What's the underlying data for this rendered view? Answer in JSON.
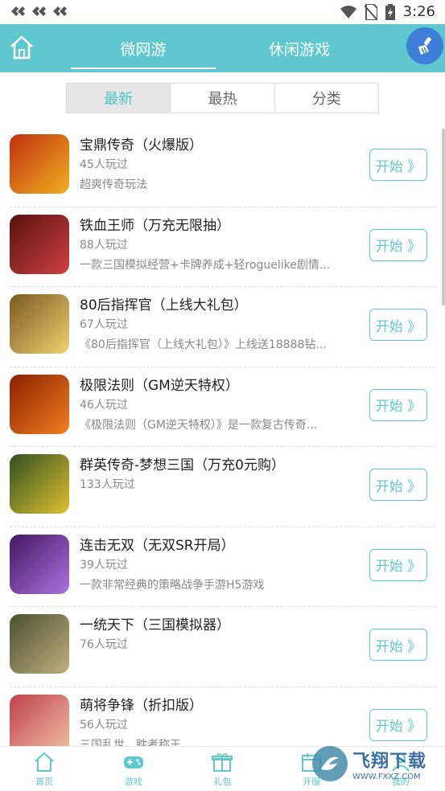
{
  "status": {
    "time": "3:26"
  },
  "header": {
    "tabs": [
      {
        "label": "微网游",
        "active": true
      },
      {
        "label": "休闲游戏",
        "active": false
      }
    ]
  },
  "segments": [
    {
      "label": "最新",
      "active": true
    },
    {
      "label": "最热",
      "active": false
    },
    {
      "label": "分类",
      "active": false
    }
  ],
  "games": [
    {
      "title": "宝鼎传奇（火爆版）",
      "players": "45人玩过",
      "desc": "超爽传奇玩法",
      "button": "开始 》",
      "icon": "game-icon-baoding",
      "colors": [
        "#c03010",
        "#f0b020"
      ]
    },
    {
      "title": "铁血王师（万充无限抽）",
      "players": "88人玩过",
      "desc": "一款三国模拟经营+卡牌养成+轻roguelike剧情...",
      "button": "开始 》",
      "icon": "game-icon-tiexue",
      "colors": [
        "#5a1010",
        "#d04040"
      ]
    },
    {
      "title": "80后指挥官（上线大礼包）",
      "players": "67人玩过",
      "desc": "《80后指挥官（上线大礼包）》上线送18888钻...",
      "button": "开始 》",
      "icon": "game-icon-80hou",
      "colors": [
        "#7a5a20",
        "#f0d070"
      ]
    },
    {
      "title": "极限法则（GM逆天特权）",
      "players": "46人玩过",
      "desc": "《极限法则（GM逆天特权）》是一款复古传奇...",
      "button": "开始 》",
      "icon": "game-icon-jixian",
      "colors": [
        "#8a2000",
        "#f08020"
      ]
    },
    {
      "title": "群英传奇-梦想三国（万充0元购）",
      "players": "133人玩过",
      "desc": "",
      "button": "开始 》",
      "icon": "game-icon-qunying",
      "colors": [
        "#305020",
        "#e0c030"
      ]
    },
    {
      "title": "连击无双（无双SR开局）",
      "players": "39人玩过",
      "desc": "一款非常经典的策略战争手游H5游戏",
      "button": "开始 》",
      "icon": "game-icon-lianji",
      "colors": [
        "#401860",
        "#b070e0"
      ]
    },
    {
      "title": "一统天下（三国模拟器）",
      "players": "76人玩过",
      "desc": "",
      "button": "开始 》",
      "icon": "game-icon-yitong",
      "colors": [
        "#4a5030",
        "#c0b080"
      ]
    },
    {
      "title": "萌将争锋（折扣版）",
      "players": "56人玩过",
      "desc": "三国乱世，胜者称王",
      "button": "开始 》",
      "icon": "game-icon-mengjiang",
      "colors": [
        "#c04050",
        "#f0c0a0"
      ]
    }
  ],
  "bottom_nav": [
    {
      "label": "首页",
      "icon": "home-icon"
    },
    {
      "label": "游戏",
      "icon": "gamepad-icon"
    },
    {
      "label": "礼包",
      "icon": "gift-icon"
    },
    {
      "label": "开服",
      "icon": "calendar-icon"
    },
    {
      "label": "我的",
      "icon": "user-icon"
    }
  ],
  "watermark": {
    "text": "飞翔下载",
    "url": "WWW.FXXZ.COM"
  }
}
